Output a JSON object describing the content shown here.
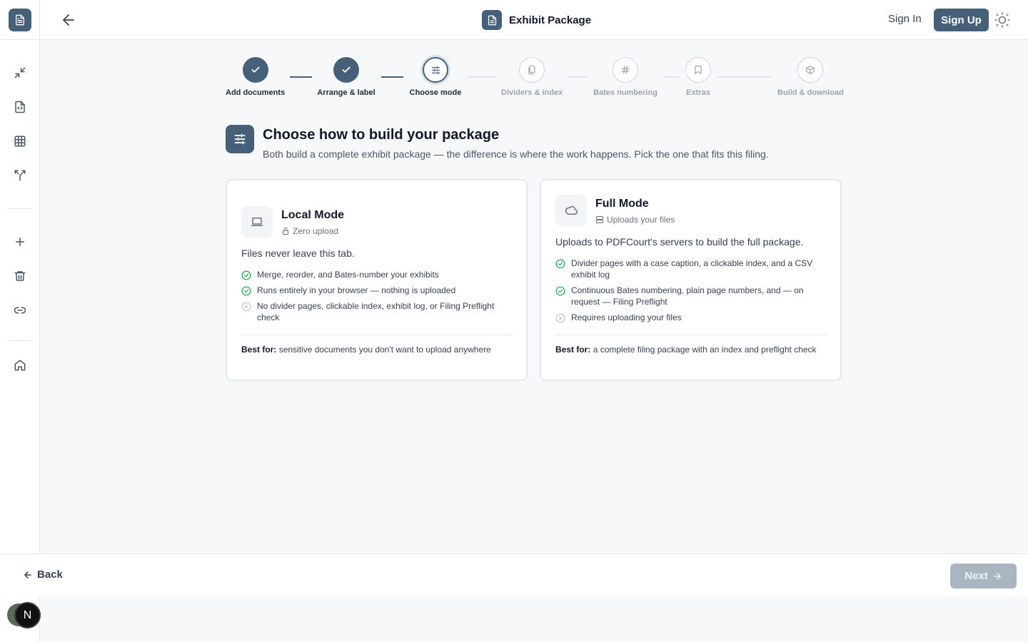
{
  "header": {
    "title": "Exhibit Package",
    "sign_in": "Sign In",
    "sign_up": "Sign Up"
  },
  "stepper": {
    "steps": [
      {
        "label": "Add documents",
        "state": "done"
      },
      {
        "label": "Arrange & label",
        "state": "done"
      },
      {
        "label": "Choose mode",
        "state": "active"
      },
      {
        "label": "Dividers & index",
        "state": "todo"
      },
      {
        "label": "Bates numbering",
        "state": "todo"
      },
      {
        "label": "Extras",
        "state": "todo"
      },
      {
        "label": "Build & download",
        "state": "todo"
      }
    ]
  },
  "main": {
    "title": "Choose how to build your package",
    "subtitle": "Both build a complete exhibit package — the difference is where the work happens. Pick the one that fits this filing."
  },
  "local_mode": {
    "title": "Local Mode",
    "tag": "Zero upload",
    "description": "Files never leave this tab.",
    "features": [
      {
        "text": "Merge, reorder, and Bates-number your exhibits",
        "included": true
      },
      {
        "text": "Runs entirely in your browser — nothing is uploaded",
        "included": true
      },
      {
        "text": "No divider pages, clickable index, exhibit log, or Filing Preflight check",
        "included": false
      }
    ],
    "best_for_label": "Best for:",
    "best_for": "sensitive documents you don't want to upload anywhere"
  },
  "full_mode": {
    "title": "Full Mode",
    "tag": "Uploads your files",
    "description": "Uploads to PDFCourt's servers to build the full package.",
    "features": [
      {
        "text": "Divider pages with a case caption, a clickable index, and a CSV exhibit log",
        "included": true
      },
      {
        "text": "Continuous Bates numbering, plain page numbers, and — on request — Filing Preflight",
        "included": true
      },
      {
        "text": "Requires uploading your files",
        "included": false
      }
    ],
    "best_for_label": "Best for:",
    "best_for": "a complete filing package with an index and preflight check"
  },
  "footer": {
    "back": "Back",
    "next": "Next"
  },
  "user": {
    "avatar_initial": "N"
  },
  "colors": {
    "accent": "#46607a",
    "success": "#16a34a",
    "muted": "#9ca3af"
  }
}
